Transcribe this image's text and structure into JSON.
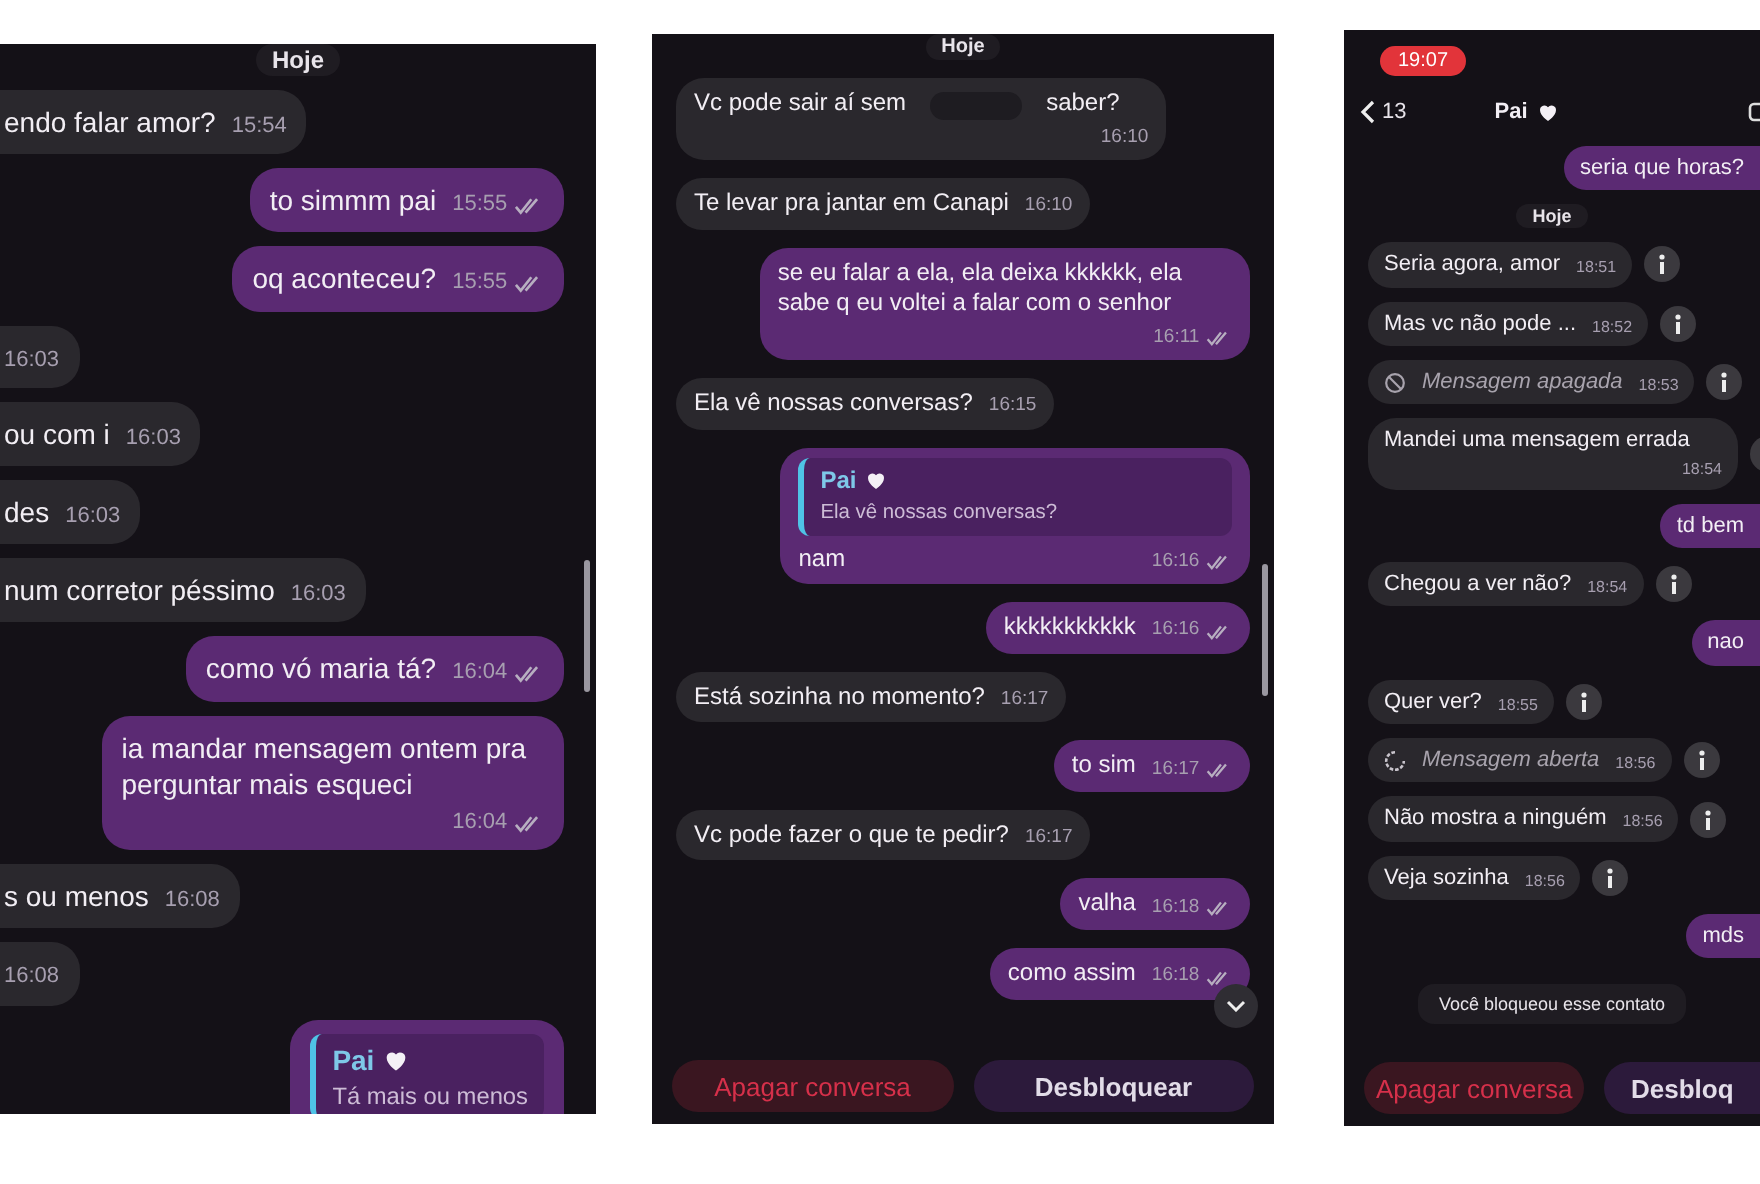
{
  "panels": [
    {
      "messages": [
        {
          "kind": "date",
          "text": "Hoje"
        },
        {
          "kind": "text",
          "outgoing": false,
          "text": "endo falar amor?",
          "time": "15:54"
        },
        {
          "kind": "text",
          "outgoing": true,
          "text": "to simmm pai",
          "time": "15:55",
          "ticks": true
        },
        {
          "kind": "text",
          "outgoing": true,
          "text": "oq aconteceu?",
          "time": "15:55",
          "ticks": true
        },
        {
          "kind": "text",
          "outgoing": false,
          "time": "16:03"
        },
        {
          "kind": "text",
          "outgoing": false,
          "text": "ou com i",
          "time": "16:03"
        },
        {
          "kind": "text",
          "outgoing": false,
          "text": "des",
          "time": "16:03"
        },
        {
          "kind": "text",
          "outgoing": false,
          "text": "num corretor péssimo",
          "time": "16:03"
        },
        {
          "kind": "text",
          "outgoing": true,
          "text": "como vó maria tá?",
          "time": "16:04",
          "ticks": true
        },
        {
          "kind": "text",
          "outgoing": true,
          "text": "ia mandar mensagem ontem pra perguntar mais esqueci",
          "time": "16:04",
          "ticks": true
        },
        {
          "kind": "text",
          "outgoing": false,
          "text": "s ou menos",
          "time": "16:08"
        },
        {
          "kind": "text",
          "outgoing": false,
          "time": "16:08"
        },
        {
          "kind": "reply",
          "outgoing": true,
          "quote_name": "Pai",
          "quote_text": "Tá mais ou menos"
        }
      ]
    },
    {
      "scroll_down_button": true,
      "messages": [
        {
          "kind": "date",
          "text": "Hoje"
        },
        {
          "kind": "redacted",
          "outgoing": false,
          "text": "Vc pode sair aí sem",
          "text_after": "saber?",
          "time": "16:10"
        },
        {
          "kind": "text",
          "outgoing": false,
          "text": "Te levar pra jantar em Canapi",
          "time": "16:10"
        },
        {
          "kind": "text",
          "outgoing": true,
          "text": "se eu falar a ela, ela deixa kkkkkk, ela sabe q eu voltei a falar com o senhor",
          "time": "16:11",
          "ticks": true
        },
        {
          "kind": "text",
          "outgoing": false,
          "text": "Ela vê nossas conversas?",
          "time": "16:15"
        },
        {
          "kind": "reply",
          "outgoing": true,
          "quote_name": "Pai",
          "quote_text": "Ela vê nossas conversas?",
          "text": "nam",
          "time": "16:16",
          "ticks": true
        },
        {
          "kind": "text",
          "outgoing": true,
          "text": "kkkkkkkkkkk",
          "time": "16:16",
          "ticks": true
        },
        {
          "kind": "text",
          "outgoing": false,
          "text": "Está sozinha no momento?",
          "time": "16:17"
        },
        {
          "kind": "text",
          "outgoing": true,
          "text": "to sim",
          "time": "16:17",
          "ticks": true
        },
        {
          "kind": "text",
          "outgoing": false,
          "text": "Vc pode fazer o que te pedir?",
          "time": "16:17"
        },
        {
          "kind": "text",
          "outgoing": true,
          "text": "valha",
          "time": "16:18",
          "ticks": true
        },
        {
          "kind": "text",
          "outgoing": true,
          "text": "como assim",
          "time": "16:18",
          "ticks": true
        }
      ],
      "actions": [
        {
          "label": "Apagar conversa",
          "kind": "danger"
        },
        {
          "label": "Desbloquear",
          "kind": "primary"
        }
      ]
    },
    {
      "status_time": "19:07",
      "header": {
        "back_count": "13",
        "contact": "Pai"
      },
      "messages": [
        {
          "kind": "text",
          "outgoing": true,
          "text": "seria que horas?"
        },
        {
          "kind": "date",
          "text": "Hoje"
        },
        {
          "kind": "text",
          "outgoing": false,
          "text": "Seria agora, amor",
          "time": "18:51",
          "info": true
        },
        {
          "kind": "text",
          "outgoing": false,
          "text": "Mas vc não pode ...",
          "time": "18:52",
          "info": true
        },
        {
          "kind": "deleted",
          "outgoing": false,
          "text": "Mensagem apagada",
          "time": "18:53",
          "info": true
        },
        {
          "kind": "text",
          "outgoing": false,
          "text": "Mandei uma mensagem errada",
          "time": "18:54",
          "info": true
        },
        {
          "kind": "text",
          "outgoing": true,
          "text": "td bem"
        },
        {
          "kind": "text",
          "outgoing": false,
          "text": "Chegou a ver não?",
          "time": "18:54",
          "info": true
        },
        {
          "kind": "text",
          "outgoing": true,
          "text": "nao"
        },
        {
          "kind": "text",
          "outgoing": false,
          "text": "Quer ver?",
          "time": "18:55",
          "info": true
        },
        {
          "kind": "opened",
          "outgoing": false,
          "text": "Mensagem aberta",
          "time": "18:56",
          "info": true
        },
        {
          "kind": "text",
          "outgoing": false,
          "text": "Não mostra a ninguém",
          "time": "18:56",
          "info": true
        },
        {
          "kind": "text",
          "outgoing": false,
          "text": "Veja sozinha",
          "time": "18:56",
          "info": true
        },
        {
          "kind": "text",
          "outgoing": true,
          "text": "mds"
        },
        {
          "kind": "notice",
          "text": "Você bloqueou esse contato"
        }
      ],
      "actions": [
        {
          "label": "Apagar conversa",
          "kind": "danger"
        },
        {
          "label": "Desbloq",
          "kind": "primary"
        }
      ]
    }
  ]
}
